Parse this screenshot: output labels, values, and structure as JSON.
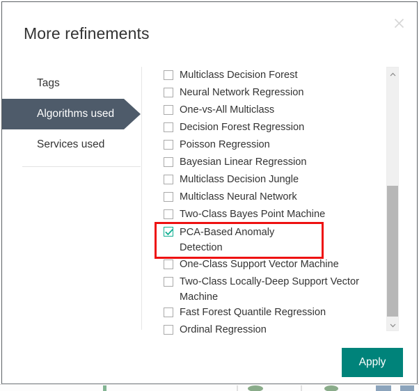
{
  "dialog": {
    "title": "More refinements",
    "close_icon": "close-icon"
  },
  "tabs": [
    {
      "label": "Tags",
      "selected": false
    },
    {
      "label": "Algorithms used",
      "selected": true
    },
    {
      "label": "Services used",
      "selected": false
    }
  ],
  "options": [
    {
      "label": "Multiclass Decision Forest",
      "checked": false,
      "highlighted": false
    },
    {
      "label": "Neural Network Regression",
      "checked": false,
      "highlighted": false
    },
    {
      "label": "One-vs-All Multiclass",
      "checked": false,
      "highlighted": false
    },
    {
      "label": "Decision Forest Regression",
      "checked": false,
      "highlighted": false
    },
    {
      "label": "Poisson Regression",
      "checked": false,
      "highlighted": false
    },
    {
      "label": "Bayesian Linear Regression",
      "checked": false,
      "highlighted": false
    },
    {
      "label": "Multiclass Decision Jungle",
      "checked": false,
      "highlighted": false
    },
    {
      "label": "Multiclass Neural Network",
      "checked": false,
      "highlighted": false
    },
    {
      "label": "Two-Class Bayes Point Machine",
      "checked": false,
      "highlighted": false
    },
    {
      "label": "PCA-Based Anomaly Detection",
      "checked": true,
      "highlighted": true
    },
    {
      "label": "One-Class Support Vector Machine",
      "checked": false,
      "highlighted": false
    },
    {
      "label": "Two-Class Locally-Deep Support Vector Machine",
      "checked": false,
      "highlighted": false
    },
    {
      "label": "Fast Forest Quantile Regression",
      "checked": false,
      "highlighted": false
    },
    {
      "label": "Ordinal Regression",
      "checked": false,
      "highlighted": false
    }
  ],
  "scrollbar": {
    "up_icon": "chevron-up-icon",
    "down_icon": "chevron-down-icon"
  },
  "footer": {
    "apply_label": "Apply"
  },
  "colors": {
    "tab_selected_bg": "#4e5b6a",
    "apply_bg": "#00837a",
    "checkbox_checked": "#0fae91",
    "highlight_outline": "#ee1111",
    "text": "#333333"
  }
}
